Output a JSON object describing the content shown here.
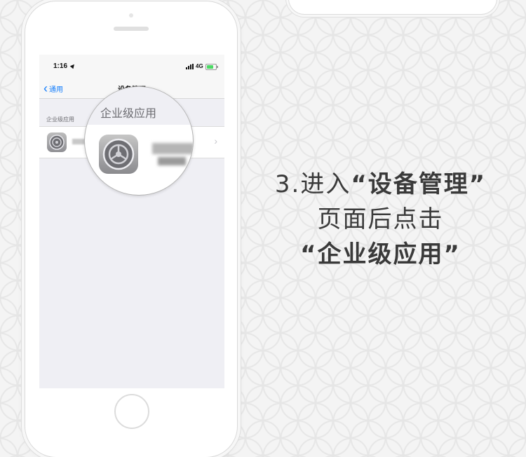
{
  "status_bar": {
    "time": "1:16",
    "network": "4G"
  },
  "nav": {
    "back_label": "通用",
    "title": "设备管理"
  },
  "section": {
    "header": "企业级应用"
  },
  "magnifier": {
    "section_header": "企业级应用"
  },
  "list_item": {
    "icon": "settings-gear-icon",
    "name_blurred": true
  },
  "caption": {
    "line1_prefix": "3.进入",
    "line1_highlight": "“设备管理”",
    "line2": "页面后点击",
    "line3": "“企业级应用”"
  },
  "colors": {
    "ios_blue": "#157efb",
    "battery_green": "#4cd964",
    "caption_text": "#3a3a3a"
  }
}
